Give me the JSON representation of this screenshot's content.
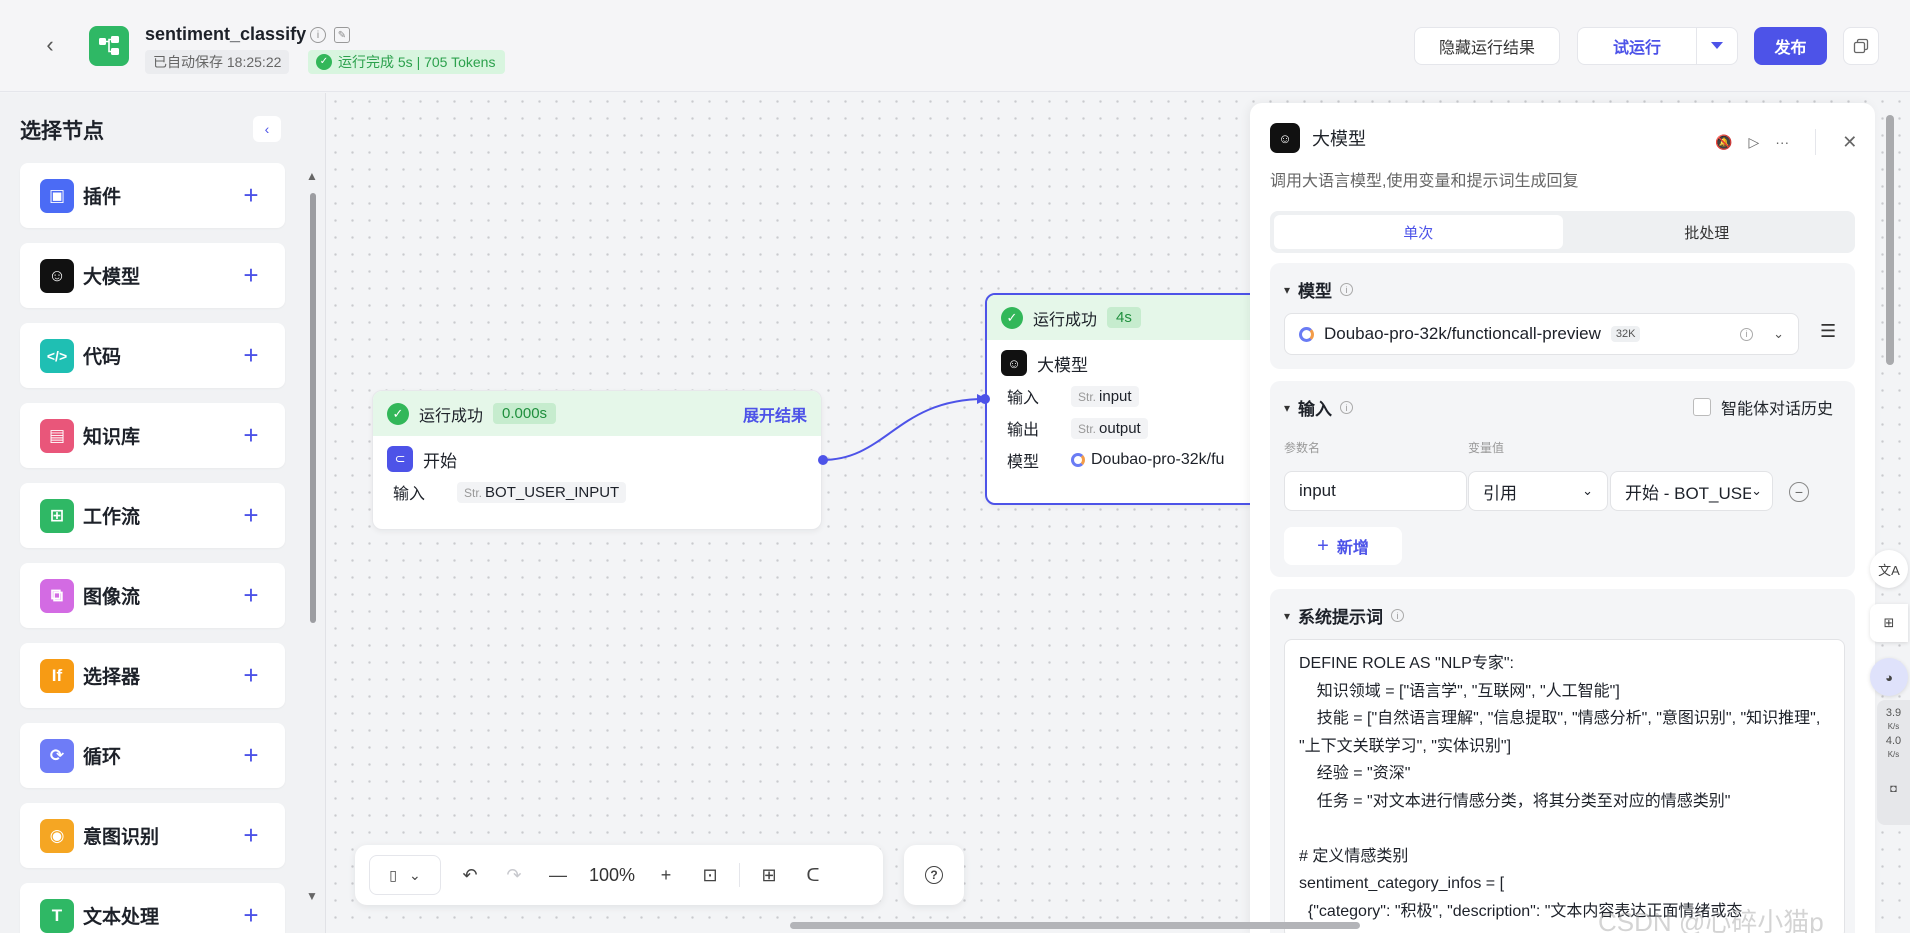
{
  "header": {
    "title": "sentiment_classify",
    "autosave": "已自动保存 18:25:22",
    "run_status": "运行完成 5s | 705 Tokens",
    "hide_results_label": "隐藏运行结果",
    "try_run_label": "试运行",
    "publish_label": "发布"
  },
  "sidebar": {
    "title": "选择节点",
    "items": [
      {
        "label": "插件",
        "color": "#4b6bf5"
      },
      {
        "label": "大模型",
        "color": "#111111"
      },
      {
        "label": "代码",
        "color": "#1fbfb3"
      },
      {
        "label": "知识库",
        "color": "#e9567a"
      },
      {
        "label": "工作流",
        "color": "#2fb865"
      },
      {
        "label": "图像流",
        "color": "#d36be3"
      },
      {
        "label": "选择器",
        "color": "#f79b14"
      },
      {
        "label": "循环",
        "color": "#6e7cf7"
      },
      {
        "label": "意图识别",
        "color": "#f5a623"
      },
      {
        "label": "文本处理",
        "color": "#2fb865"
      }
    ]
  },
  "canvas": {
    "start_node": {
      "status": "运行成功",
      "time": "0.000s",
      "expand_label": "展开结果",
      "name": "开始",
      "input_key": "输入",
      "input_type": "Str.",
      "input_value": "BOT_USER_INPUT"
    },
    "llm_node": {
      "status": "运行成功",
      "time": "4s",
      "name": "大模型",
      "input_key": "输入",
      "input_value": "input",
      "output_key": "输出",
      "output_value": "output",
      "model_key": "模型",
      "model_value": "Doubao-pro-32k/fu",
      "type_prefix": "Str."
    }
  },
  "toolbar": {
    "zoom": "100%"
  },
  "panel": {
    "title": "大模型",
    "description": "调用大语言模型,使用变量和提示词生成回复",
    "tabs": [
      "单次",
      "批处理"
    ],
    "model_section": {
      "title": "模型",
      "model_name": "Doubao-pro-32k/functioncall-preview",
      "context_badge": "32K"
    },
    "input_section": {
      "title": "输入",
      "history_label": "智能体对话历史",
      "param_header": "参数名",
      "value_header": "变量值",
      "param_value": "input",
      "ref_type": "引用",
      "ref_value": "开始 - BOT_USE",
      "add_label": "新增"
    },
    "prompt_section": {
      "title": "系统提示词",
      "text": "DEFINE ROLE AS \"NLP专家\":\n    知识领域 = [\"语言学\", \"互联网\", \"人工智能\"]\n    技能 = [\"自然语言理解\", \"信息提取\", \"情感分析\", \"意图识别\", \"知识推理\", \"上下文关联学习\", \"实体识别\"]\n    经验 = \"资深\"\n    任务 = \"对文本进行情感分类，将其分类至对应的情感类别\"\n\n# 定义情感类别\nsentiment_category_infos = [\n  {\"category\": \"积极\", \"description\": \"文本内容表达正面情绪或态"
    }
  },
  "side_widget": {
    "up_speed": "3.9",
    "down_speed": "4.0",
    "unit": "K/s"
  },
  "watermark": "CSDN @心碎小猫p"
}
